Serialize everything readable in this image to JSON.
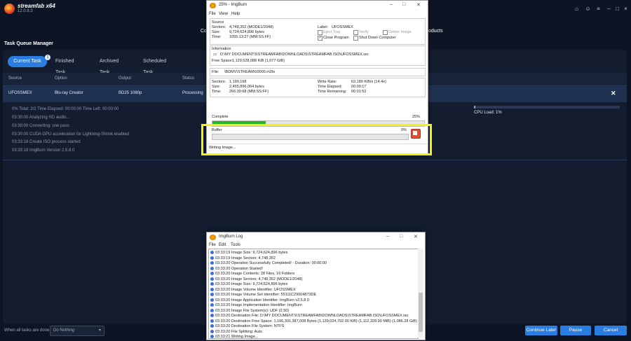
{
  "app": {
    "name": "streamfab x64",
    "version": "12.0.8.3",
    "tqm_title": "Task Queue Manager",
    "co_text": "Co",
    "products_text": "Products"
  },
  "tabs": [
    {
      "label": "Current Task",
      "badge": "1"
    },
    {
      "label": "Finished Task"
    },
    {
      "label": "Archived Task"
    },
    {
      "label": "Scheduled Task"
    }
  ],
  "columns": [
    "Source",
    "Option",
    "Output",
    "Status"
  ],
  "task": {
    "source": "UFOSSMEX",
    "option": "Blu-ray Creator",
    "output": "BD25 1080p",
    "status": "Processing"
  },
  "progress_line": "0%   Total: 2/2  Time Elapsed: 00:00:00  Time Left: 00:00:00",
  "log_lines": [
    "03:30:00  Analyzing HD audio...",
    "03:30:00  Converting: one pass",
    "03:30:00  CUDA GPU acceleration for Lightning-Shrink enabled",
    "03:33:18  Create ISO process started",
    "03:33:18  ImgBurn Version 2.5.8.0"
  ],
  "cpu": {
    "label": "CPU Load: 1%",
    "value": 1
  },
  "bottom": {
    "when_done_label": "When all tasks are done:",
    "when_done_value": "Do Nothing",
    "continue_label": "Continue Later",
    "pause_label": "Pause",
    "cancel_label": "Cancel"
  },
  "imgburn": {
    "title": "25% - ImgBurn",
    "menu": [
      "File",
      "View",
      "Help"
    ],
    "source_label": "Source",
    "sectors_label": "Sectors:",
    "sectors_value": "4,748,352 (MODE1/2048)",
    "size_label": "Size:",
    "size_value": "9,724,624,896 bytes",
    "time_label": "Time:",
    "time_value": "1055:13:27 (MM:SS:FF)",
    "label_label": "Label:",
    "label_value": "UFOSSMEX",
    "eject_tray": "Eject Tray",
    "verify": "Verify",
    "delete_image": "Delete Image",
    "close_program": "Close Program",
    "shutdown": "Shut Down Computer",
    "information_label": "Information",
    "info_path": "D:\\MY DOCUMENTS\\STREAMFAB\\DOWNLOADS\\STREAMFAB ISO\\UFOSSMEX.iso",
    "free_space_label": "Free Space:",
    "free_space_value": "1,129,528,088 KiB  (1,077 GiB)",
    "file_label": "File:",
    "file_value": "\\BDMV\\STREAM\\00000.m2ts",
    "f_sectors_value": "1,199,168",
    "f_size_value": "2,455,896,064 bytes",
    "f_time_value": "266:30:68 (MM:SS:FF)",
    "write_rate_label": "Write Rate:",
    "write_rate_value": "63,180 KiB/s (14.4x)",
    "elapsed_label": "Time Elapsed:",
    "elapsed_value": "00:00:17",
    "remaining_label": "Time Remaining:",
    "remaining_value": "00:01:52",
    "complete_label": "Complete",
    "complete_pct": "25%",
    "complete_value": 25,
    "buffer_label": "Buffer",
    "buffer_pct": "0%",
    "buffer_value": 0,
    "status": "Writing Image..."
  },
  "imgburn_log": {
    "title": "ImgBurn Log",
    "menu": [
      "File",
      "Edit",
      "Tools"
    ],
    "lines": [
      "03:33:19 Image Size: 9,724,624,896 bytes",
      "03:33:19 Image Sectors: 4,748,352",
      "03:33:20 Operation Successfully Completed! - Duration: 00:00:00",
      "03:33:20 Operation Started!",
      "03:33:20 Image Contents: 28 Files, 16 Folders",
      "03:33:20 Image Sectors: 4,748,352 (MODE1/2048)",
      "03:33:20 Image Size: 9,724,624,896 bytes",
      "03:33:20 Image Volume Identifier: UFOSSMEX",
      "03:33:20 Image Volume Set Identifier: 55111C29004873DE",
      "03:33:20 Image Application Identifier: ImgBurn v2.5.8.0",
      "03:33:20 Image Implementation Identifier: ImgBurn",
      "03:33:20 Image File System(s): UDF (2.50)",
      "03:33:20 Destination File: D:\\MY DOCUMENTS\\STREAMFAB\\DOWNLOADS\\STREAMFAB ISO\\UFOSSMEX.iso",
      "03:33:20 Destination Free Space: 1,166,301,387,008 Bytes (1,139,024,792.00 KiB) (1,112,328.90 MiB) (1,086.28 GiB)",
      "03:33:20 Destination File System: NTFS",
      "03:33:20 File Splitting: Auto",
      "03:33:21 Writing Image..."
    ]
  },
  "colors": {
    "accent": "#2a7de1",
    "highlight": "#f2f21a",
    "progress": "#28b428"
  }
}
